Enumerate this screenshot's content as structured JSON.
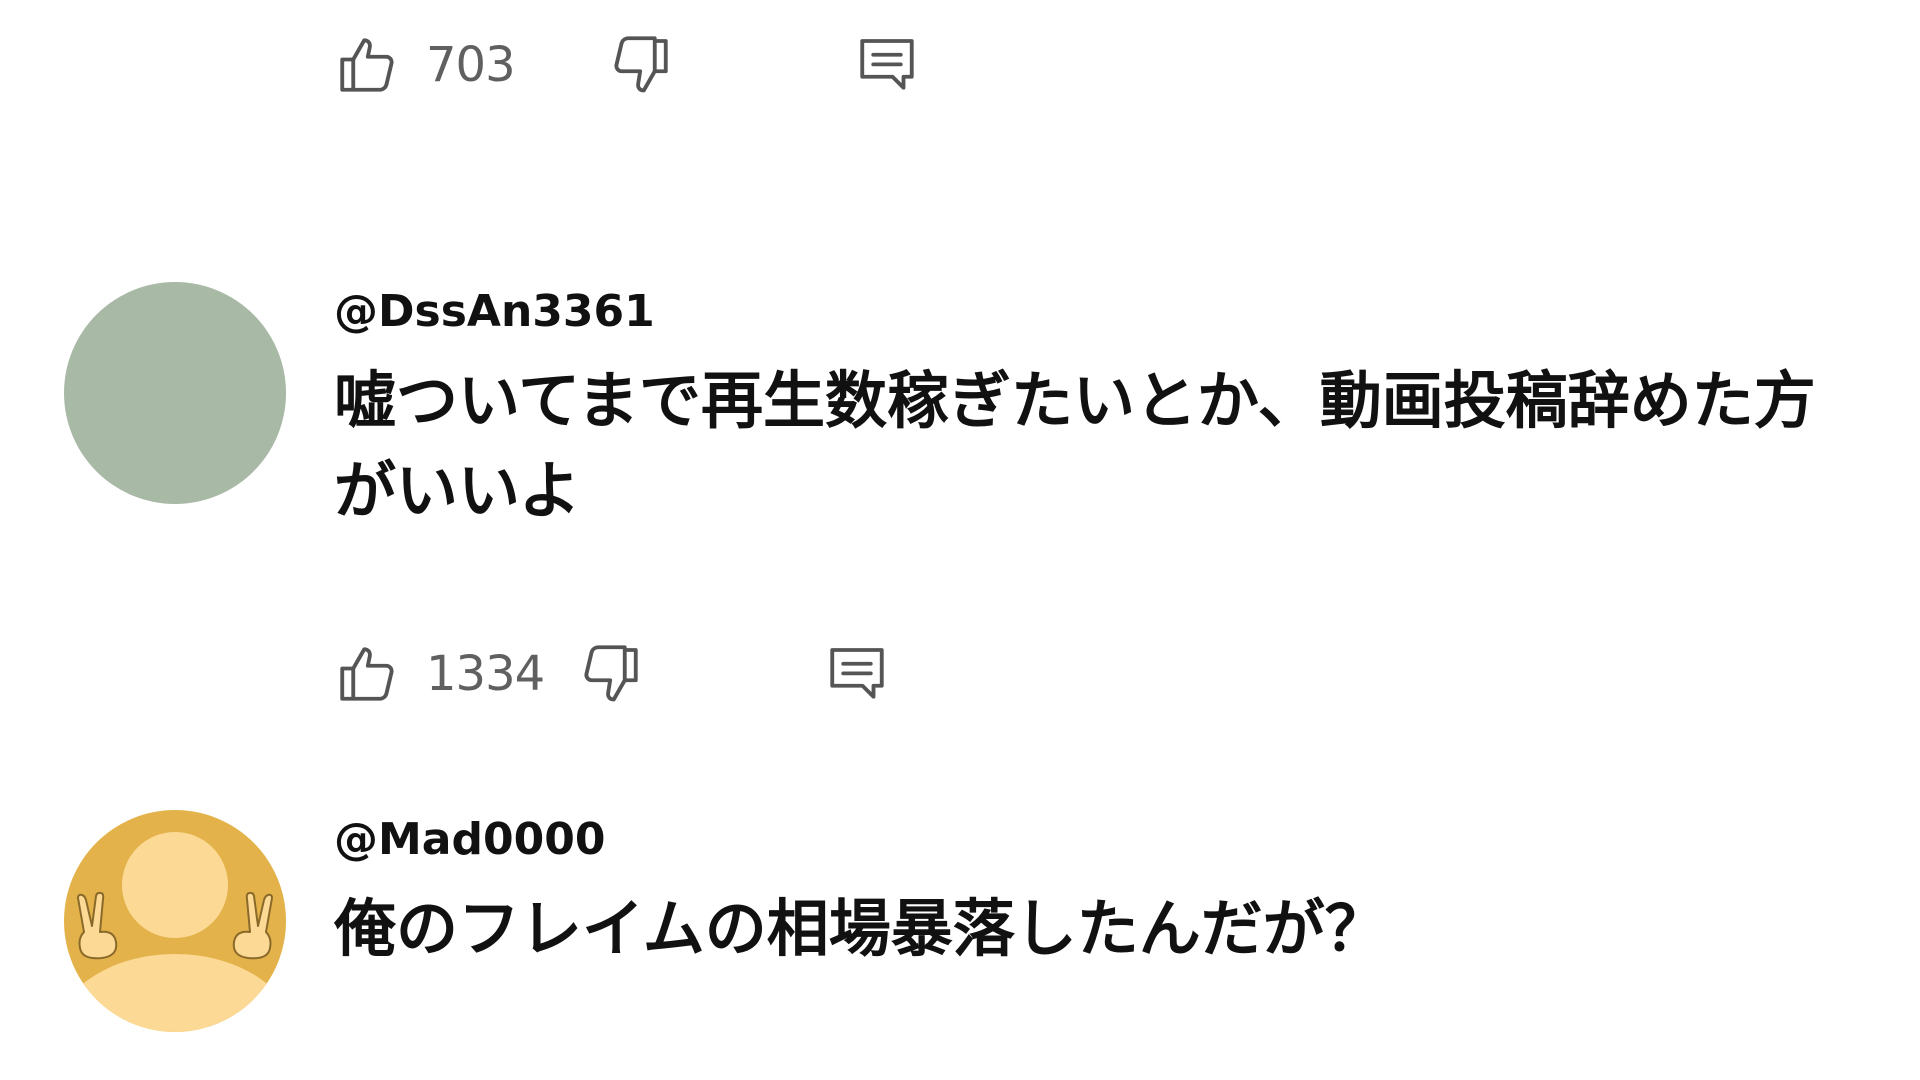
{
  "top_actions": {
    "like_count": "703",
    "like_icon": "thumbs-up-icon",
    "dislike_icon": "thumbs-down-icon",
    "reply_icon": "comment-icon"
  },
  "comments": [
    {
      "handle": "@DssAn3361",
      "text": "嘘ついてまで再生数稼ぎたいとか、動画投稿辞めた方がいいよ",
      "avatar": "solid-color-avatar",
      "avatar_color": "#a8b9a5",
      "like_count": "1334"
    },
    {
      "handle": "@Mad0000",
      "text": "俺のフレイムの相場暴落したんだが？",
      "avatar": "default-user-avatar",
      "avatar_color": "#e4b24a"
    }
  ],
  "colors": {
    "icon": "#555555",
    "count": "#606060",
    "text": "#111111",
    "background": "#ffffff"
  }
}
